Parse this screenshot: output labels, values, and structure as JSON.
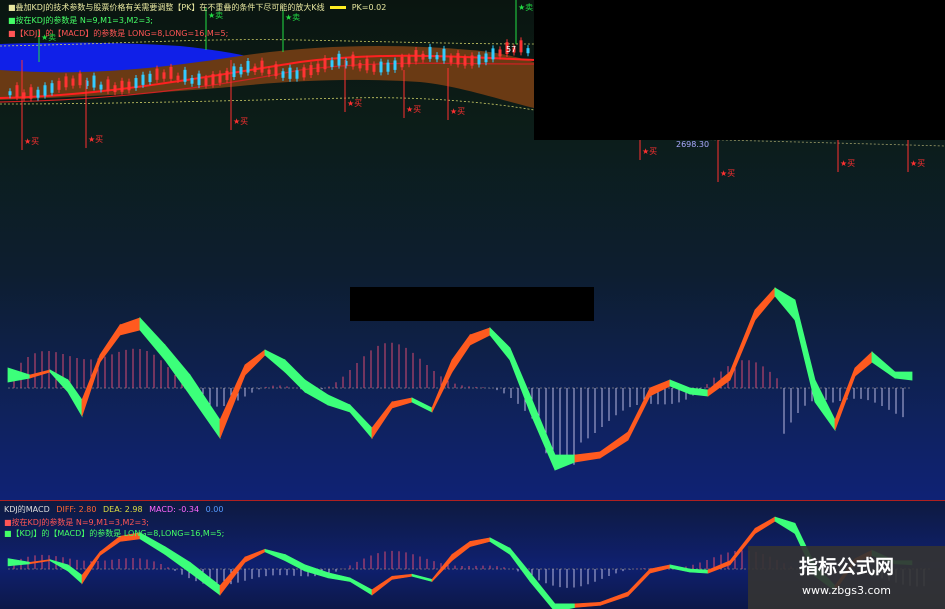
{
  "top_panel": {
    "legend_lines": [
      {
        "text": "■叠加KDJ的技术参数与股票价格有关需要调整【PK】在不重叠的条件下尽可能的放大K线",
        "color": "#e8e8a0"
      },
      {
        "text": "■按在KDJ的参数是 N=9,M1=3,M2=3;",
        "color": "#44ff66"
      },
      {
        "text": "■【KDJ】的【MACD】的参数是 LONG=8,LONG=16,M=5;",
        "color": "#ff5555"
      }
    ],
    "pk_label": "PK=0.02",
    "price_tag": "57",
    "price_level": "2698.30",
    "buy_label": "买",
    "sell_label": "卖"
  },
  "lower_panel": {
    "indicator_name": "KDJ的MACD",
    "values": [
      {
        "text": "DIFF: 2.80",
        "color": "#ff6633"
      },
      {
        "text": "DEA: 2.98",
        "color": "#dddd44"
      },
      {
        "text": "MACD: -0.34",
        "color": "#ff66ff"
      },
      {
        "text": "0.00",
        "color": "#5599ff"
      }
    ],
    "legend_lines": [
      {
        "text": "■按在KDJ的参数是 N=9,M1=3,M2=3;",
        "color": "#ff5555"
      },
      {
        "text": "■【KDJ】的【MACD】的参数是 LONG=8,LONG=16,M=5;",
        "color": "#44ff66"
      }
    ]
  },
  "watermark": {
    "title": "指标公式网",
    "url": "www.zbgs3.com"
  },
  "colors": {
    "rise": "#ff5a1f",
    "fall": "#3cff7a",
    "red_signal": "#ff3030",
    "green_signal": "#22dd44"
  }
}
